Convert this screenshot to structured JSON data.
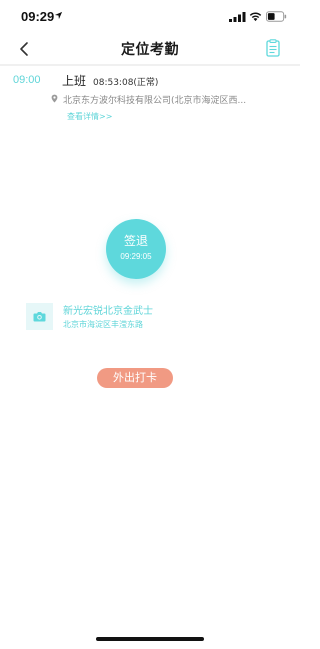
{
  "status_bar": {
    "time": "09:29",
    "icons": [
      "location-arrow-icon",
      "cellular-signal-icon",
      "wifi-icon",
      "battery-icon"
    ]
  },
  "nav": {
    "title": "定位考勤",
    "left_icon": "back-chevron-icon",
    "right_icon": "attendance-record-icon"
  },
  "record": {
    "time": "09:00",
    "type": "上班",
    "status": "08:53:08(正常)",
    "address": "北京东方波尔科技有限公司(北京市海淀区西...",
    "detail_link": "查看详情>>"
  },
  "clock": {
    "label": "签退",
    "time": "09:29:05"
  },
  "location": {
    "name": "新光宏锐北京金武士",
    "address": "北京市海淀区丰滢东路"
  },
  "outdoor_button": "外出打卡",
  "colors": {
    "accent": "#5ed8dc",
    "accent_text": "#5fd5d8",
    "button_orange": "#f19a83",
    "camera_bg": "#e6f7f8"
  }
}
